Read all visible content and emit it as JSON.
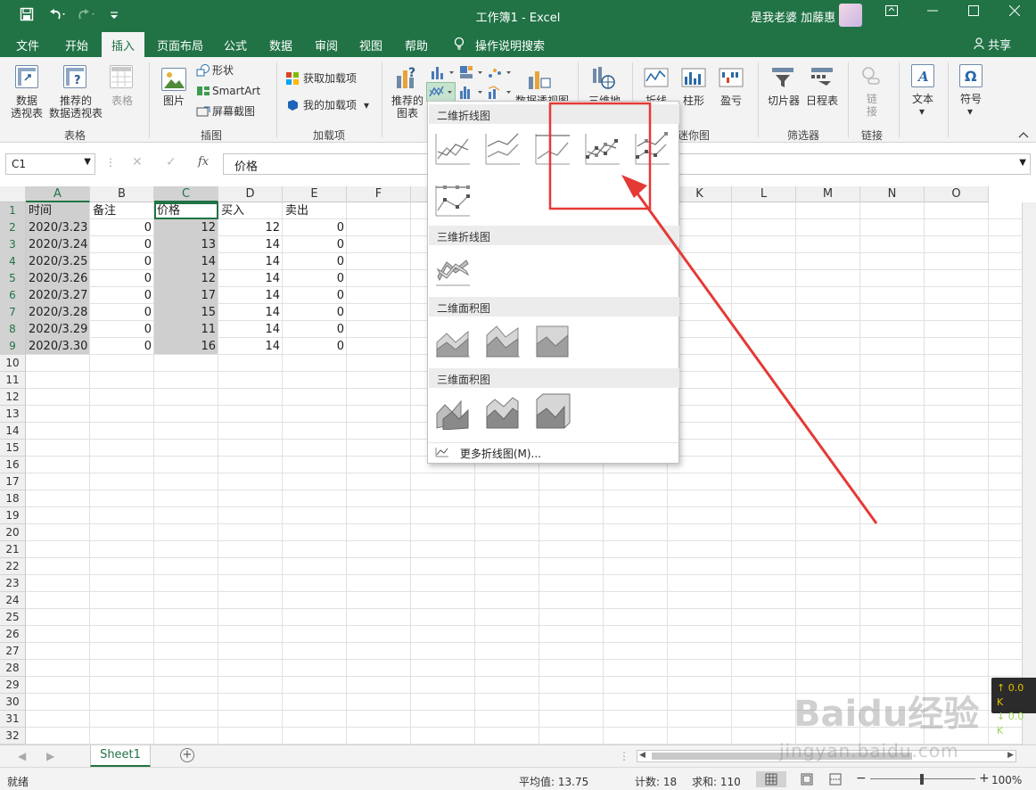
{
  "titlebar": {
    "title": "工作簿1 - Excel",
    "user": "是我老婆 加藤惠",
    "save_icon": "save-icon",
    "undo_icon": "undo-icon",
    "redo_icon": "redo-icon",
    "customize_icon": "customize-icon"
  },
  "tabs": [
    "文件",
    "开始",
    "插入",
    "页面布局",
    "公式",
    "数据",
    "审阅",
    "视图",
    "帮助",
    "操作说明搜索"
  ],
  "active_tab": "插入",
  "share": "共享",
  "ribbon": {
    "pivot": "数据\n透视表",
    "rec_pivot": "推荐的\n数据透视表",
    "table": "表格",
    "group_table": "表格",
    "picture": "图片",
    "shapes": "形状",
    "smartart": "SmartArt",
    "screenshot": "屏幕截图",
    "group_illustrations": "插图",
    "get_addins": "获取加载项",
    "my_addins": "我的加载项",
    "group_addins": "加载项",
    "rec_charts": "推荐的\n图表",
    "pivot_chart": "数据透视图",
    "map3d": "三维地",
    "spark_line": "折线",
    "spark_col": "柱形",
    "spark_wl": "盈亏",
    "group_spark": "迷你图",
    "slicer": "切片器",
    "timeline": "日程表",
    "group_filter": "筛选器",
    "link": "链\n接",
    "group_link": "链接",
    "text": "文本",
    "symbol": "符号"
  },
  "formula": {
    "namebox": "C1",
    "content": "价格"
  },
  "columns": [
    "A",
    "B",
    "C",
    "D",
    "E",
    "F",
    "G",
    "H",
    "I",
    "J",
    "K",
    "L",
    "M",
    "N",
    "O"
  ],
  "rows": [
    "1",
    "2",
    "3",
    "4",
    "5",
    "6",
    "7",
    "8",
    "9",
    "10",
    "11",
    "12",
    "13",
    "14",
    "15",
    "16",
    "17",
    "18",
    "19",
    "20",
    "21",
    "22",
    "23",
    "24",
    "25",
    "26",
    "27",
    "28",
    "29",
    "30",
    "31",
    "32"
  ],
  "table": {
    "headers": [
      "时间",
      "备注",
      "价格",
      "买入",
      "卖出"
    ],
    "data": [
      [
        "2020/3.23",
        "0",
        "12",
        "12",
        "0"
      ],
      [
        "2020/3.24",
        "0",
        "13",
        "14",
        "0"
      ],
      [
        "2020/3.25",
        "0",
        "14",
        "14",
        "0"
      ],
      [
        "2020/3.26",
        "0",
        "12",
        "14",
        "0"
      ],
      [
        "2020/3.27",
        "0",
        "17",
        "14",
        "0"
      ],
      [
        "2020/3.28",
        "0",
        "15",
        "14",
        "0"
      ],
      [
        "2020/3.29",
        "0",
        "11",
        "14",
        "0"
      ],
      [
        "2020/3.30",
        "0",
        "16",
        "14",
        "0"
      ]
    ]
  },
  "dropdown": {
    "sec1": "二维折线图",
    "sec2": "三维折线图",
    "sec3": "二维面积图",
    "sec4": "三维面积图",
    "more": "更多折线图(M)..."
  },
  "sheet": "Sheet1",
  "status": {
    "ready": "就绪",
    "avg": "平均值: 13.75",
    "count": "计数: 18",
    "sum": "求和: 110",
    "zoom": "100%"
  },
  "netmon": {
    "up": "↑ 0.0 K",
    "down": "↓ 0.0 K"
  },
  "watermark": {
    "brand": "Baidu经验",
    "url": "jingyan.baidu.com"
  },
  "colors": {
    "excel_green": "#217346",
    "annotation_red": "#e53935"
  }
}
